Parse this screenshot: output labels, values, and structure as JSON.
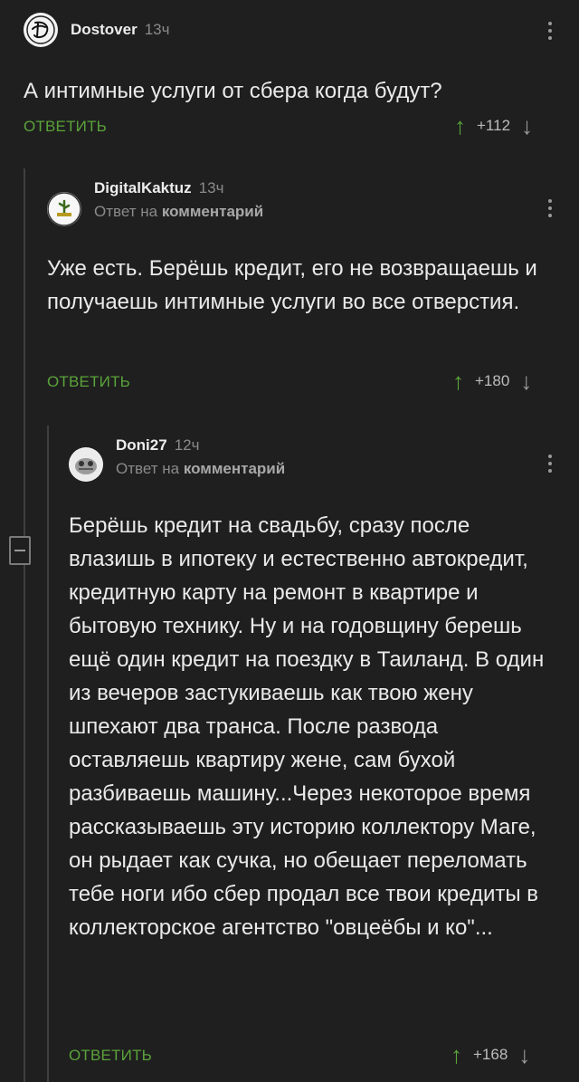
{
  "comments": [
    {
      "username": "Dostover",
      "time": "13ч",
      "text": "А интимные услуги от сбера когда будут?",
      "reply_label": "ОТВЕТИТЬ",
      "rating": "+112"
    },
    {
      "username": "DigitalKaktuz",
      "time": "13ч",
      "reply_to_prefix": "Ответ на",
      "reply_to_link": "комментарий",
      "text": "Уже есть. Берёшь кредит, его не возвращаешь и получаешь интимные услуги во все отверстия.",
      "reply_label": "ОТВЕТИТЬ",
      "rating": "+180"
    },
    {
      "username": "Doni27",
      "time": "12ч",
      "reply_to_prefix": "Ответ на",
      "reply_to_link": "комментарий",
      "text": "Берёшь кредит на свадьбу, сразу после влазишь в ипотеку и естественно автокредит, кредитную карту на ремонт в квартире и бытовую технику. Ну и на годовщину берешь ещё один кредит на поездку в Таиланд. В один из вечеров застукиваешь как твою жену шпехают два транса. После развода оставляешь квартиру жене, сам бухой разбиваешь машину...Через некоторое время рассказываешь эту историю коллектору Маге, он рыдает как сучка, но обещает переломать тебе ноги ибо сбер продал все твои кредиты в коллекторское агентство \"овцеёбы и ко\"...",
      "reply_label": "ОТВЕТИТЬ",
      "rating": "+168"
    }
  ],
  "icons": {
    "upvote": "↑",
    "downvote": "↓"
  },
  "colors": {
    "accent_green": "#5aa33a",
    "background": "#1f1f1f"
  }
}
